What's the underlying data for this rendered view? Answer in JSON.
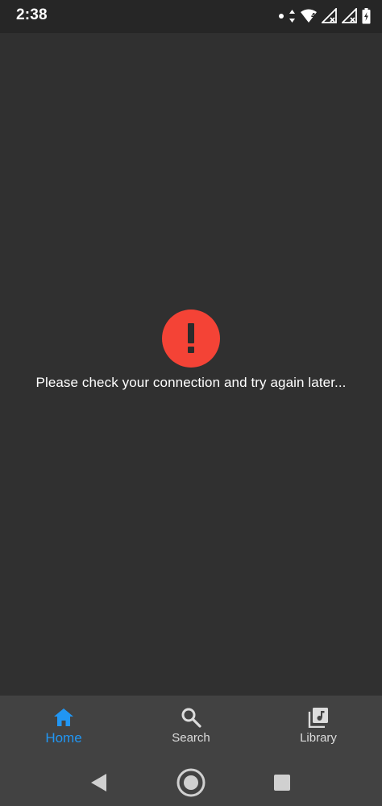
{
  "status_bar": {
    "time": "2:38",
    "icons": [
      "notification-dot-icon",
      "data-arrows-icon",
      "wifi-icon",
      "signal-no-service-icon",
      "signal-no-service-icon",
      "battery-charging-icon"
    ]
  },
  "error": {
    "icon": "exclamation-icon",
    "message": "Please check your connection and try again later..."
  },
  "bottom_nav": {
    "items": [
      {
        "label": "Home",
        "icon": "home-icon",
        "active": true
      },
      {
        "label": "Search",
        "icon": "search-icon",
        "active": false
      },
      {
        "label": "Library",
        "icon": "library-icon",
        "active": false
      }
    ]
  },
  "system_nav": {
    "buttons": [
      "back-triangle-icon",
      "home-circle-icon",
      "recents-square-icon"
    ]
  },
  "colors": {
    "background": "#303030",
    "status_bar": "#262626",
    "nav_bar": "#424242",
    "accent": "#2196f3",
    "error": "#f44336"
  }
}
